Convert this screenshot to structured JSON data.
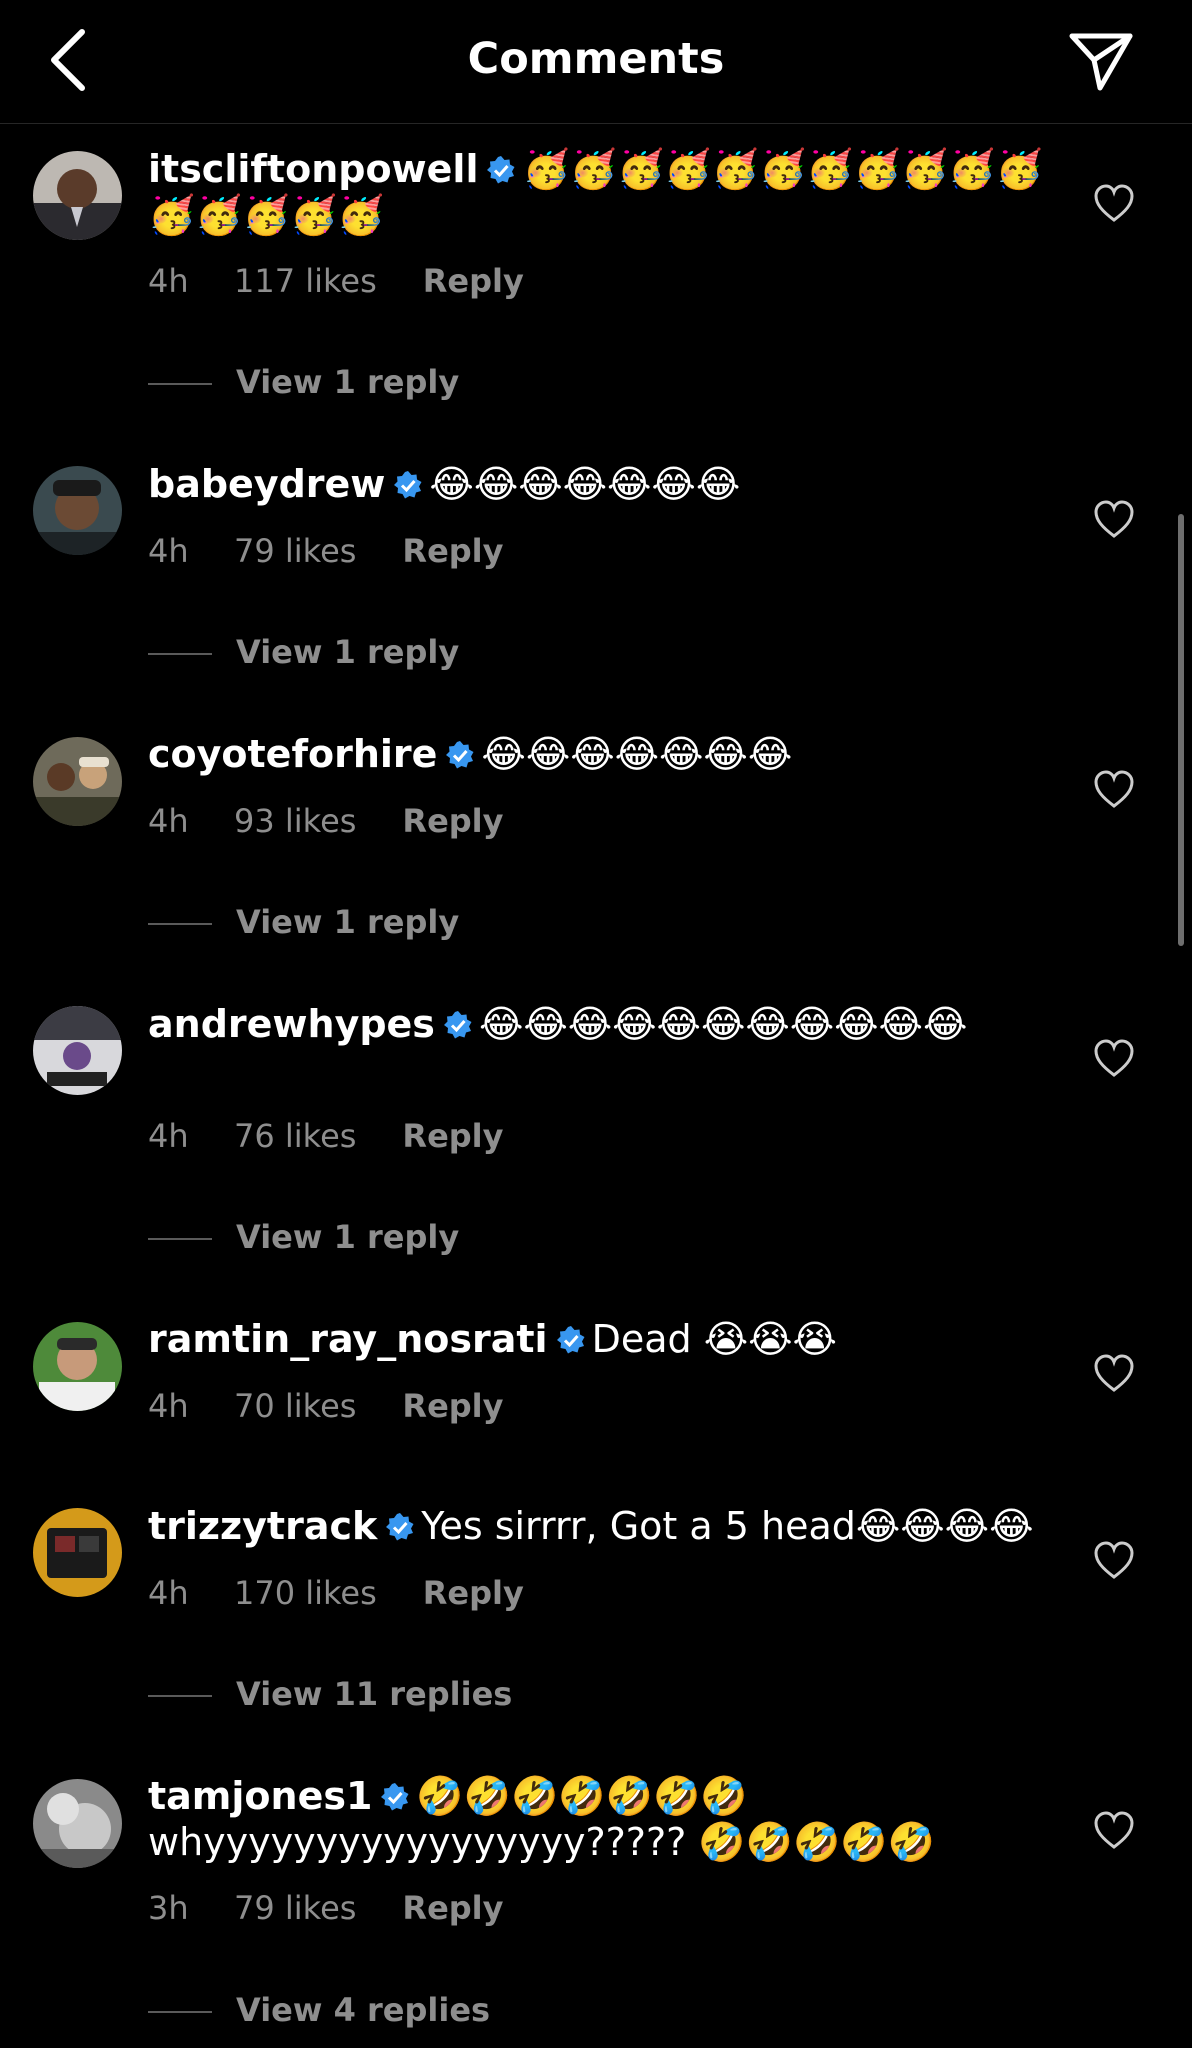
{
  "header": {
    "title": "Comments"
  },
  "comments": [
    {
      "username": "itscliftonpowell",
      "text": "🥳🥳🥳🥳🥳🥳🥳🥳🥳🥳🥳🥳🥳🥳🥳🥳",
      "time": "4h",
      "likes": "117 likes",
      "reply": "Reply",
      "view_replies": "View 1 reply"
    },
    {
      "username": "babeydrew",
      "text": "😂😂😂😂😂😂😂",
      "time": "4h",
      "likes": "79 likes",
      "reply": "Reply",
      "view_replies": "View 1 reply"
    },
    {
      "username": "coyoteforhire",
      "text": "😂😂😂😂😂😂😂",
      "time": "4h",
      "likes": "93 likes",
      "reply": "Reply",
      "view_replies": "View 1 reply"
    },
    {
      "username": "andrewhypes",
      "text": "😂😂😂😂😂😂😂😂😂😂😂",
      "time": "4h",
      "likes": "76 likes",
      "reply": "Reply",
      "view_replies": "View 1 reply"
    },
    {
      "username": "ramtin_ray_nosrati",
      "text": "Dead 😭😭😭",
      "time": "4h",
      "likes": "70 likes",
      "reply": "Reply"
    },
    {
      "username": "trizzytrack",
      "text": "Yes sirrrr, Got a 5 head😂😂😂😂",
      "time": "4h",
      "likes": "170 likes",
      "reply": "Reply",
      "view_replies": "View 11 replies"
    },
    {
      "username": "tamjones1",
      "text": "🤣🤣🤣🤣🤣🤣🤣 whyyyyyyyyyyyyyyyyy????? 🤣🤣🤣🤣🤣",
      "time": "3h",
      "likes": "79 likes",
      "reply": "Reply",
      "view_replies": "View 4 replies"
    }
  ],
  "icons": {
    "back": "chevron-left-icon",
    "send": "send-icon",
    "verified": "verified-badge-icon",
    "like": "heart-outline-icon"
  },
  "colors": {
    "background": "#000000",
    "text": "#ffffff",
    "muted": "#8e8e8e",
    "verified": "#3897f0"
  }
}
